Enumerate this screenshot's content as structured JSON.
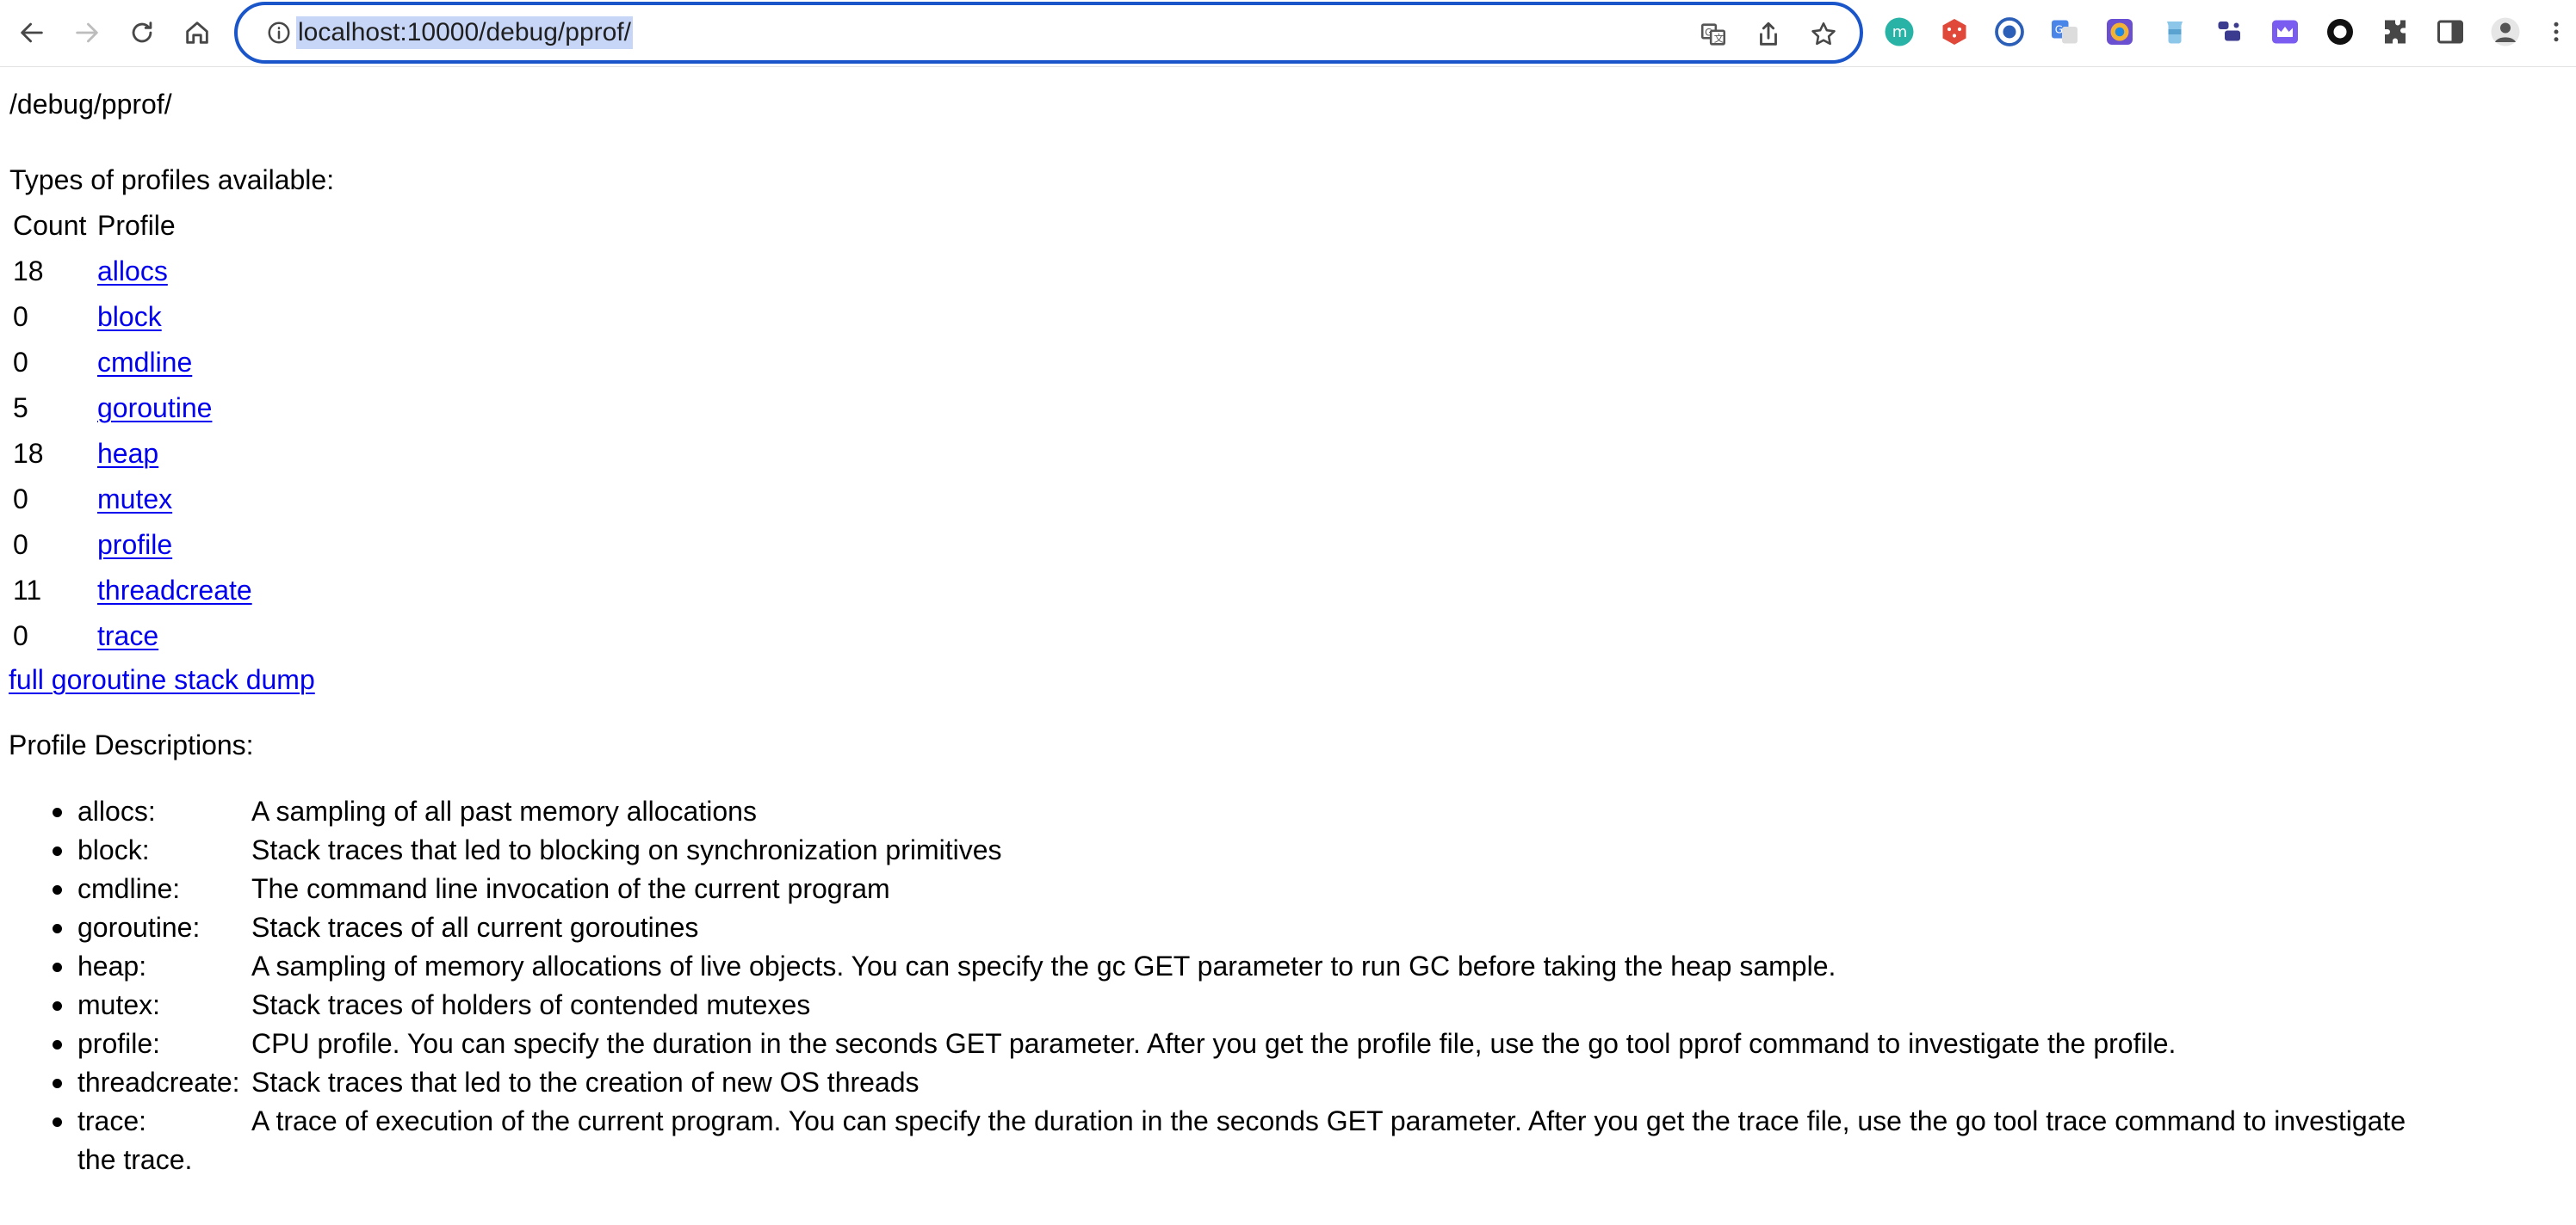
{
  "browser": {
    "url": "localhost:10000/debug/pprof/",
    "extensions": [
      "monica-icon",
      "dice-icon",
      "circle-c-icon",
      "google-translate-icon",
      "chrome-color-icon",
      "jar-icon",
      "jetbrains-icon",
      "crown-icon",
      "ring-icon",
      "puzzle-icon",
      "side-panel-icon",
      "avatar-icon",
      "more-icon"
    ]
  },
  "page": {
    "path_heading": "/debug/pprof/",
    "types_heading": "Types of profiles available:",
    "table": {
      "headers": [
        "Count",
        "Profile"
      ],
      "rows": [
        {
          "count": "18",
          "profile": "allocs"
        },
        {
          "count": "0",
          "profile": "block"
        },
        {
          "count": "0",
          "profile": "cmdline"
        },
        {
          "count": "5",
          "profile": "goroutine"
        },
        {
          "count": "18",
          "profile": "heap"
        },
        {
          "count": "0",
          "profile": "mutex"
        },
        {
          "count": "0",
          "profile": "profile"
        },
        {
          "count": "11",
          "profile": "threadcreate"
        },
        {
          "count": "0",
          "profile": "trace"
        }
      ]
    },
    "full_dump_link": "full goroutine stack dump",
    "descriptions_heading": "Profile Descriptions:",
    "descriptions": [
      {
        "name": "allocs:",
        "text": "A sampling of all past memory allocations"
      },
      {
        "name": "block:",
        "text": "Stack traces that led to blocking on synchronization primitives"
      },
      {
        "name": "cmdline:",
        "text": "The command line invocation of the current program"
      },
      {
        "name": "goroutine:",
        "text": "Stack traces of all current goroutines"
      },
      {
        "name": "heap:",
        "text": "A sampling of memory allocations of live objects. You can specify the gc GET parameter to run GC before taking the heap sample."
      },
      {
        "name": "mutex:",
        "text": "Stack traces of holders of contended mutexes"
      },
      {
        "name": "profile:",
        "text": "CPU profile. You can specify the duration in the seconds GET parameter. After you get the profile file, use the go tool pprof command to investigate the profile."
      },
      {
        "name": "threadcreate:",
        "text": "Stack traces that led to the creation of new OS threads"
      },
      {
        "name": "trace:",
        "text": "A trace of execution of the current program. You can specify the duration in the seconds GET parameter. After you get the trace file, use the go tool trace command to investigate",
        "text_cont": "the trace."
      }
    ]
  }
}
